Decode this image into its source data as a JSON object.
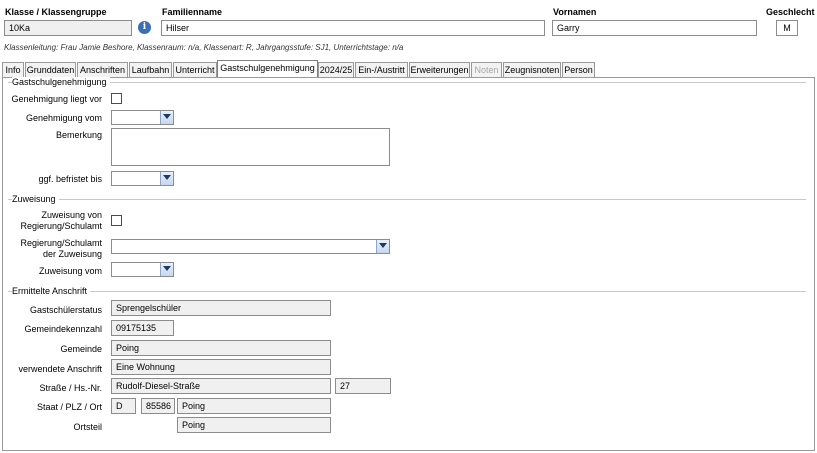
{
  "header": {
    "klasse_label": "Klasse / Klassengruppe",
    "klasse_value": "10Ka",
    "info_icon_glyph": "i",
    "familienname_label": "Familienname",
    "familienname_value": "Hilser",
    "vornamen_label": "Vornamen",
    "vornamen_value": "Garry",
    "geschlecht_label": "Geschlecht",
    "geschlecht_value": "M",
    "klassenleitung_line": "Klassenleitung: Frau Jamie Beshore, Klassenraum: n/a, Klassenart: R, Jahrgangsstufe: SJ1, Unterrichtstage: n/a"
  },
  "tabs": [
    {
      "label": "Info"
    },
    {
      "label": "Grunddaten"
    },
    {
      "label": "Anschriften"
    },
    {
      "label": "Laufbahn"
    },
    {
      "label": "Unterricht"
    },
    {
      "label": "Gastschulgenehmigung",
      "active": true
    },
    {
      "label": "2024/25"
    },
    {
      "label": "Ein-/Austritt"
    },
    {
      "label": "Erweiterungen"
    },
    {
      "label": "Noten",
      "disabled": true
    },
    {
      "label": "Zeugnisnoten"
    },
    {
      "label": "Person"
    }
  ],
  "gastschul": {
    "section_title": "Gastschulgenehmigung",
    "genehmigung_liegt_vor_label": "Genehmigung liegt vor",
    "genehmigung_liegt_vor_checked": false,
    "genehmigung_vom_label": "Genehmigung vom",
    "genehmigung_vom_value": "",
    "bemerkung_label": "Bemerkung",
    "bemerkung_value": "",
    "befristet_label": "ggf. befristet bis",
    "befristet_value": ""
  },
  "zuweisung": {
    "section_title": "Zuweisung",
    "zuweisung_label_1": "Zuweisung von",
    "zuweisung_label_2": "Regierung/Schulamt",
    "zuweisung_checked": false,
    "regierung_label_1": "Regierung/Schulamt",
    "regierung_label_2": "der Zuweisung",
    "regierung_value": "",
    "zuweisung_vom_label": "Zuweisung vom",
    "zuweisung_vom_value": ""
  },
  "anschrift": {
    "section_title": "Ermittelte Anschrift",
    "status_label": "Gastschülerstatus",
    "status_value": "Sprengelschüler",
    "gkz_label": "Gemeindekennzahl",
    "gkz_value": "09175135",
    "gemeinde_label": "Gemeinde",
    "gemeinde_value": "Poing",
    "verwendete_label": "verwendete Anschrift",
    "verwendete_value": "Eine Wohnung",
    "strasse_label": "Straße / Hs.-Nr.",
    "strasse_value": "Rudolf-Diesel-Straße",
    "hausnr_value": "27",
    "staat_label": "Staat / PLZ / Ort",
    "staat_value": "D",
    "plz_value": "85586",
    "ort_value": "Poing",
    "ortsteil_label": "Ortsteil",
    "ortsteil_value": "Poing"
  }
}
